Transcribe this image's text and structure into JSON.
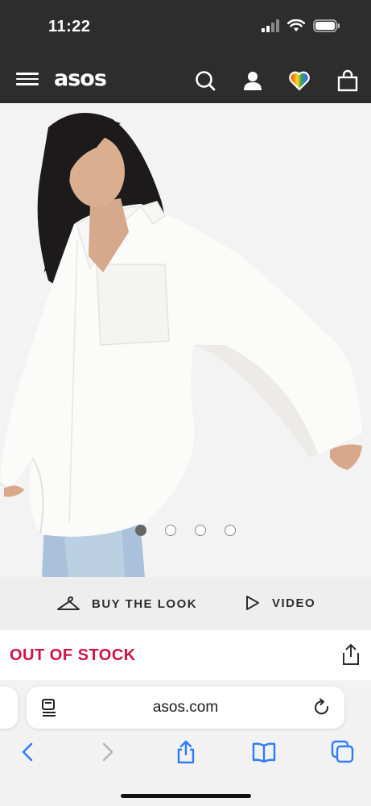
{
  "status": {
    "time": "11:22"
  },
  "header": {
    "logo": "asos",
    "icons": [
      "menu-icon",
      "search-icon",
      "account-icon",
      "saved-items-heart-icon",
      "bag-icon"
    ]
  },
  "gallery": {
    "image_count": 4,
    "active_index": 0
  },
  "actions": {
    "buy_the_look": "BUY THE LOOK",
    "video": "VIDEO"
  },
  "product": {
    "stock_status": "OUT OF STOCK"
  },
  "browser": {
    "url": "asos.com",
    "toolbar": [
      "back-icon",
      "forward-icon",
      "share-icon",
      "bookmarks-icon",
      "tabs-icon"
    ]
  },
  "colors": {
    "header_bg": "#2d2d2d",
    "stock_red": "#d01345",
    "ios_blue": "#2e7cf6"
  }
}
